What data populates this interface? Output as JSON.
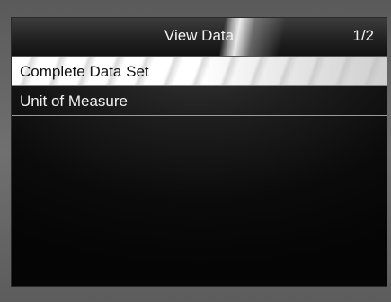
{
  "header": {
    "title": "View Data",
    "page_indicator": "1/2"
  },
  "menu": {
    "items": [
      {
        "label": "Complete Data Set",
        "selected": true
      },
      {
        "label": "Unit of Measure",
        "selected": false
      }
    ]
  }
}
